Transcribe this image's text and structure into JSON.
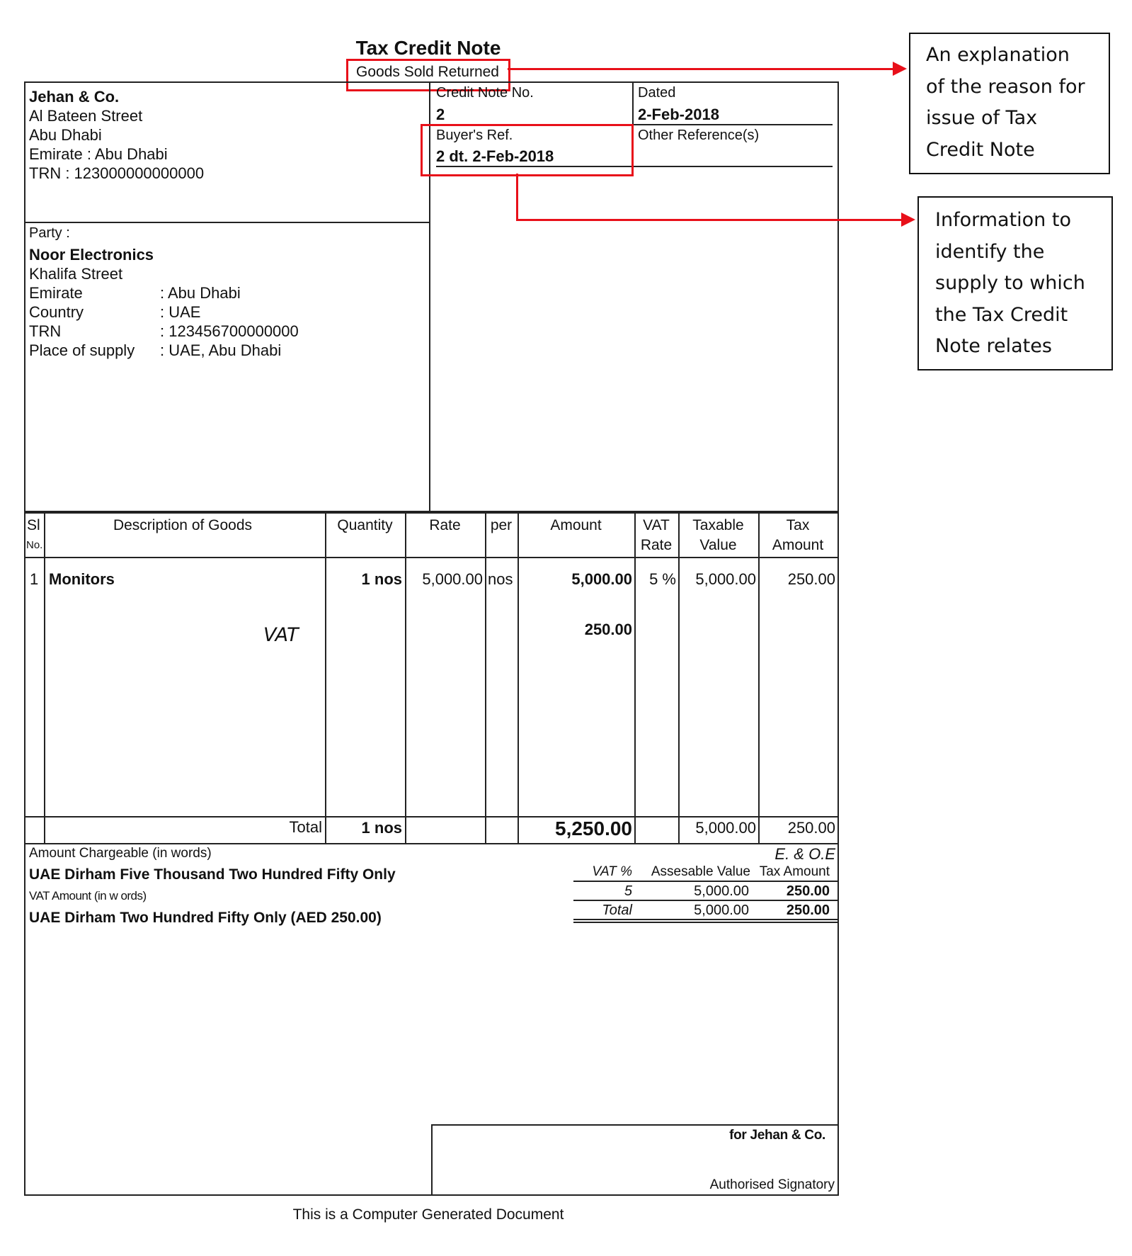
{
  "document": {
    "title": "Tax Credit Note",
    "reason": "Goods Sold Returned",
    "seller": {
      "name": "Jehan & Co.",
      "address_lines": [
        "Al Bateen Street",
        "Abu Dhabi",
        "Emirate : Abu Dhabi",
        "TRN : 123000000000000"
      ]
    },
    "party": {
      "label": "Party :",
      "name": "Noor Electronics",
      "street": "Khalifa Street",
      "fields": [
        {
          "label": "Emirate",
          "value": ": Abu Dhabi"
        },
        {
          "label": "Country",
          "value": ": UAE"
        },
        {
          "label": "TRN",
          "value": ": 123456700000000"
        },
        {
          "label": "Place of supply",
          "value": ": UAE, Abu Dhabi"
        }
      ]
    },
    "refs": {
      "credit_note_no_label": "Credit Note No.",
      "credit_note_no": "2",
      "dated_label": "Dated",
      "dated": "2-Feb-2018",
      "buyers_ref_label": "Buyer's Ref.",
      "buyers_ref": "2  dt. 2-Feb-2018",
      "other_refs_label": "Other Reference(s)",
      "other_refs": ""
    },
    "table": {
      "headers": {
        "sl": "Sl",
        "sl_no": "No.",
        "description": "Description of Goods",
        "quantity": "Quantity",
        "rate": "Rate",
        "per": "per",
        "amount": "Amount",
        "vat_rate_1": "VAT",
        "vat_rate_2": "Rate",
        "taxable_1": "Taxable",
        "taxable_2": "Value",
        "tax_amt_1": "Tax",
        "tax_amt_2": "Amount"
      },
      "rows": [
        {
          "sl": "1",
          "description": "Monitors",
          "quantity": "1 nos",
          "rate": "5,000.00",
          "per": "nos",
          "amount": "5,000.00",
          "vat_rate": "5 %",
          "taxable_value": "5,000.00",
          "tax_amount": "250.00"
        }
      ],
      "vat_line": {
        "label": "VAT",
        "amount": "250.00"
      },
      "total": {
        "label": "Total",
        "quantity": "1 nos",
        "amount": "5,250.00",
        "taxable_value": "5,000.00",
        "tax_amount": "250.00"
      }
    },
    "words": {
      "amount_label": "Amount Chargeable (in words)",
      "amount_words": "UAE Dirham Five Thousand Two Hundred Fifty Only",
      "vat_label": "VAT Amount (in w ords)",
      "vat_words": "UAE Dirham Two Hundred Fifty Only (AED 250.00)",
      "eoe": "E. & O.E"
    },
    "vat_summary": {
      "headers": {
        "vat_pct": "VAT %",
        "assessable": "Assesable Value",
        "tax_amount": "Tax Amount"
      },
      "rows": [
        {
          "vat_pct": "5",
          "assessable": "5,000.00",
          "tax_amount": "250.00"
        }
      ],
      "total": {
        "label": "Total",
        "assessable": "5,000.00",
        "tax_amount": "250.00"
      }
    },
    "signature": {
      "for_label": "for Jehan & Co.",
      "signatory": "Authorised Signatory"
    },
    "footer": "This is a Computer Generated Document"
  },
  "annotations": {
    "color": "#e8101a",
    "callout_reason": [
      "An explanation",
      "of the reason for",
      "issue of Tax",
      "Credit Note"
    ],
    "callout_supply": [
      "Information to",
      "identify the",
      "supply to which",
      "the Tax Credit",
      "Note relates"
    ]
  }
}
